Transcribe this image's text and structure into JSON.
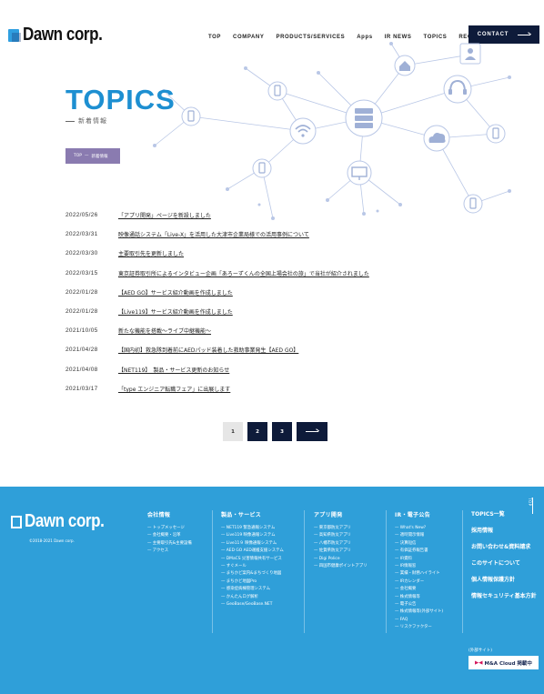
{
  "header": {
    "logo": "Dawn corp.",
    "nav": [
      "TOP",
      "COMPANY",
      "PRODUCTS/SERVICES",
      "Apps",
      "IR NEWS",
      "TOPICS",
      "RECRUIT"
    ],
    "contact_label": "CONTACT"
  },
  "hero": {
    "title": "TOPICS",
    "subtitle": "新着情報",
    "breadcrumb": [
      "TOP",
      "—",
      "新着情報"
    ]
  },
  "news": [
    {
      "date": "2022/05/26",
      "title": "「アプリ開発」ページを新設しました"
    },
    {
      "date": "2022/03/31",
      "title": "映像通話システム「Live-X」を活用した大津市企業局様での活用事例について"
    },
    {
      "date": "2022/03/30",
      "title": "主要取引先を更新しました"
    },
    {
      "date": "2022/03/15",
      "title": "東京証券取引所によるインタビュー企画「あろーずくんの全国上場会社の旅」で当社が紹介されました"
    },
    {
      "date": "2022/01/28",
      "title": "【AED GO】サービス紹介動画を作成しました"
    },
    {
      "date": "2022/01/28",
      "title": "【Live119】サービス紹介動画を作成しました"
    },
    {
      "date": "2021/10/05",
      "title": "新たな機能を搭載〜ライブ中継機能〜"
    },
    {
      "date": "2021/04/28",
      "title": "【国内初】救急隊到着前にAEDパッド装着した救助事業発生【AED GO】"
    },
    {
      "date": "2021/04/08",
      "title": "【NET119】　製品・サービス更新のお知らせ"
    },
    {
      "date": "2021/03/17",
      "title": "「type エンジニア転職フェア」に出展します"
    }
  ],
  "pager": {
    "pages": [
      "1",
      "2",
      "3"
    ],
    "current": "1"
  },
  "footer": {
    "logo": "Dawn corp.",
    "copyright": "©2018-2021 Dawn corp.",
    "columns": [
      {
        "title": "会社情報",
        "links": [
          "トップメッセージ",
          "会社概要・沿革",
          "主要取引先&主要設備",
          "アクセス"
        ]
      },
      {
        "title": "製品・サービス",
        "links": [
          "NET119 緊急通報システム",
          "Live119 映像通報システム",
          "Live11９ 映像通報システム",
          "AED GO AED運搬支援システム",
          "DMaCS 災害情報共有サービス",
          "すぐメール",
          "まちかど案内&まちづくり地図",
          "まちかど地図Pro",
          "感染症病棟管理システム",
          "かんたんログ解析",
          "GeoBase/GeoBase.NET"
        ]
      },
      {
        "title": "アプリ開発",
        "links": [
          "東京都防災アプリ",
          "高知県防災アプリ",
          "八幡市防災アプリ",
          "佐賀県防災アプリ",
          "Digi Police",
          "四国市健康ポイントアプリ"
        ]
      },
      {
        "title": "IR・電子公告",
        "links": [
          "What's New?",
          "適時開示情報",
          "決算短信",
          "有価証券報告書",
          "IR資料",
          "IR情報窓",
          "業績・財務ハイライト",
          "IRカレンダー",
          "会社概要",
          "株式情報等",
          "電子公告",
          "株式情報等(外部サイト)",
          "FAQ",
          "リスクファクター"
        ]
      }
    ],
    "right_links": [
      "TOPICS一覧",
      "採用情報",
      "お問い合わせ&資料請求",
      "このサイトについて",
      "個人情報保護方針",
      "情報セキュリティ基本方針"
    ],
    "pagetop": "TOP",
    "ext_label": "(外部サイト)",
    "badge": "M&A Cloud 掲載中"
  },
  "colors": {
    "accent": "#1d8fd1",
    "navy": "#0e1b3a",
    "footer": "#2f9fd9",
    "breadcrumb": "#8a7bb0"
  }
}
